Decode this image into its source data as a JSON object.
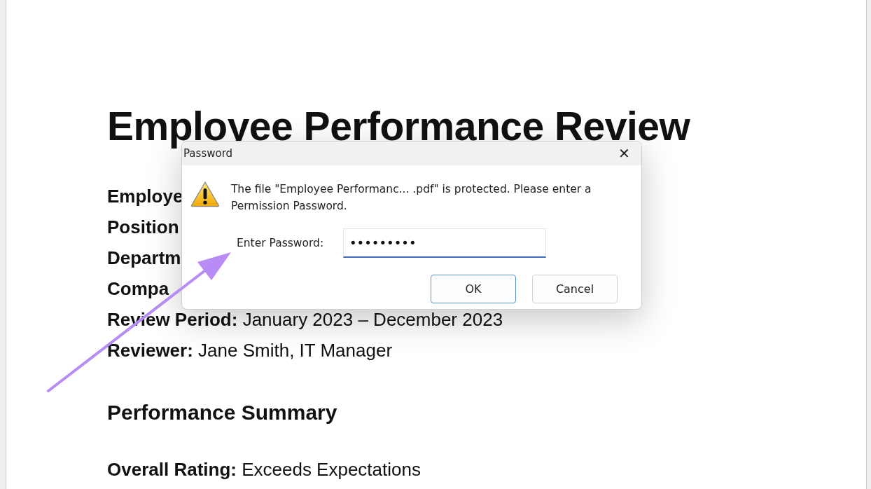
{
  "document": {
    "title": "Employee Performance Review",
    "fields": [
      {
        "label": "Employe"
      },
      {
        "label": "Position"
      },
      {
        "label": "Departm"
      },
      {
        "label": "Compa"
      },
      {
        "label": "Review Period:",
        "value": "January 2023 – December 2023"
      },
      {
        "label": "Reviewer:",
        "value": "Jane Smith, IT Manager"
      }
    ],
    "section_heading": "Performance Summary",
    "summary_fields": [
      {
        "label": "Overall Rating:",
        "value": "Exceeds Expectations"
      }
    ]
  },
  "dialog": {
    "title": "Password",
    "close": "✕",
    "message": "The file \"Employee Performanc... .pdf\" is protected. Please enter a Permission Password.",
    "field_label": "Enter Password:",
    "field_value": "•••••••••",
    "buttons": [
      {
        "label": "OK",
        "default": true
      },
      {
        "label": "Cancel",
        "default": false
      }
    ]
  }
}
